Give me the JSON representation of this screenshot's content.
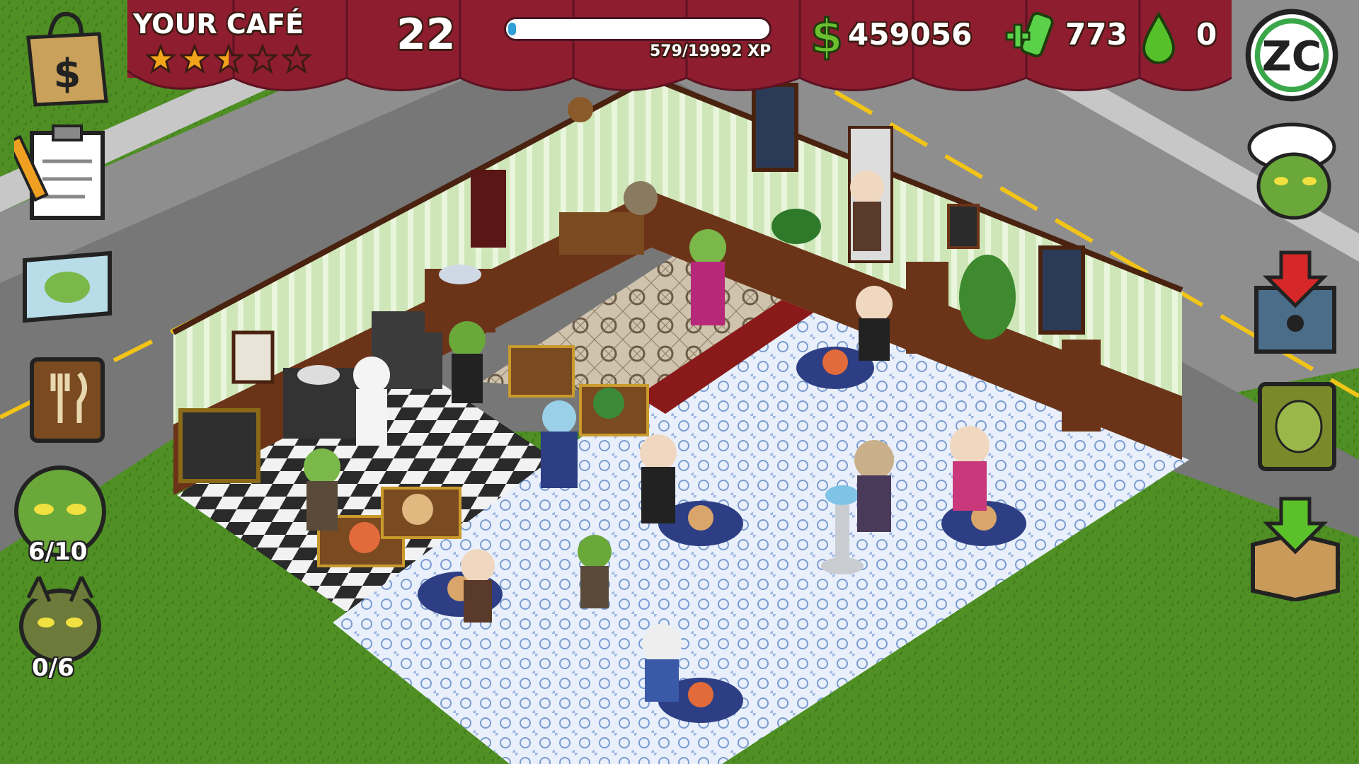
{
  "cafe": {
    "title": "YOUR CAFÉ",
    "stars_total": 5,
    "stars_rating": 2.5
  },
  "level": "22",
  "xp": {
    "label": "579/19992 XP",
    "fraction": 0.029
  },
  "currency": {
    "cash_icon": "dollar-icon",
    "cash": "459056",
    "serum_icon": "serum-vial-icon",
    "serum": "773",
    "drops_icon": "green-drop-icon",
    "drops": "0"
  },
  "left_menu": [
    {
      "icon": "shopping-bag-icon"
    },
    {
      "icon": "clipboard-checklist-icon"
    },
    {
      "icon": "map-scroll-icon"
    },
    {
      "icon": "recipe-book-icon"
    },
    {
      "icon": "zombie-head-icon",
      "count": "6/10"
    },
    {
      "icon": "zombie-dog-icon",
      "count": "0/6"
    }
  ],
  "right_menu": [
    {
      "icon": "zc-logo-icon"
    },
    {
      "icon": "zombie-chef-icon"
    },
    {
      "icon": "storage-box-icon"
    },
    {
      "icon": "zombie-book-icon"
    },
    {
      "icon": "inventory-box-icon"
    }
  ],
  "colors": {
    "awning": "#8e1d30",
    "awning_dark": "#5e1222",
    "grass": "#4f8f24",
    "wall_stripe": "#cfe7b8"
  }
}
